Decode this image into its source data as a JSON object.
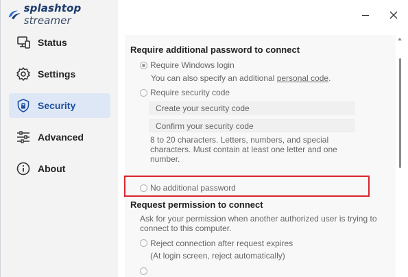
{
  "app": {
    "logo_bold": "splashtop",
    "logo_light": "streamer"
  },
  "sidebar": {
    "items": [
      {
        "label": "Status",
        "icon": "monitor-icon"
      },
      {
        "label": "Settings",
        "icon": "gear-icon"
      },
      {
        "label": "Security",
        "icon": "shield-lock-icon",
        "active": true
      },
      {
        "label": "Advanced",
        "icon": "sliders-icon"
      },
      {
        "label": "About",
        "icon": "info-icon"
      }
    ]
  },
  "window_controls": {
    "minimize": "minimize-icon",
    "close": "close-icon"
  },
  "security": {
    "section1_title": "Require additional password to connect",
    "opt_windows_login": "Require Windows login",
    "windows_login_note_prefix": "You can also specify an additional ",
    "windows_login_note_link": "personal code",
    "windows_login_note_suffix": ".",
    "opt_security_code": "Require security code",
    "create_code_placeholder": "Create your security code",
    "confirm_code_placeholder": "Confirm your security code",
    "code_rules_line1": "8 to 20 characters. Letters, numbers, and special",
    "code_rules_line2": "characters. Must contain at least one letter and one",
    "code_rules_line3": "number.",
    "opt_no_password": "No additional password",
    "section2_title": "Request permission to connect",
    "permission_note_line1": "Ask for your permission when another authorized user is trying to",
    "permission_note_line2": "connect to this computer.",
    "opt_reject": "Reject connection after request expires",
    "reject_note": "(At login screen, reject automatically)"
  },
  "colors": {
    "active_nav_bg": "#dde7f6",
    "active_nav_text": "#1f4f9e",
    "highlight_border": "#d8262d",
    "brand": "#1d3c6d"
  }
}
